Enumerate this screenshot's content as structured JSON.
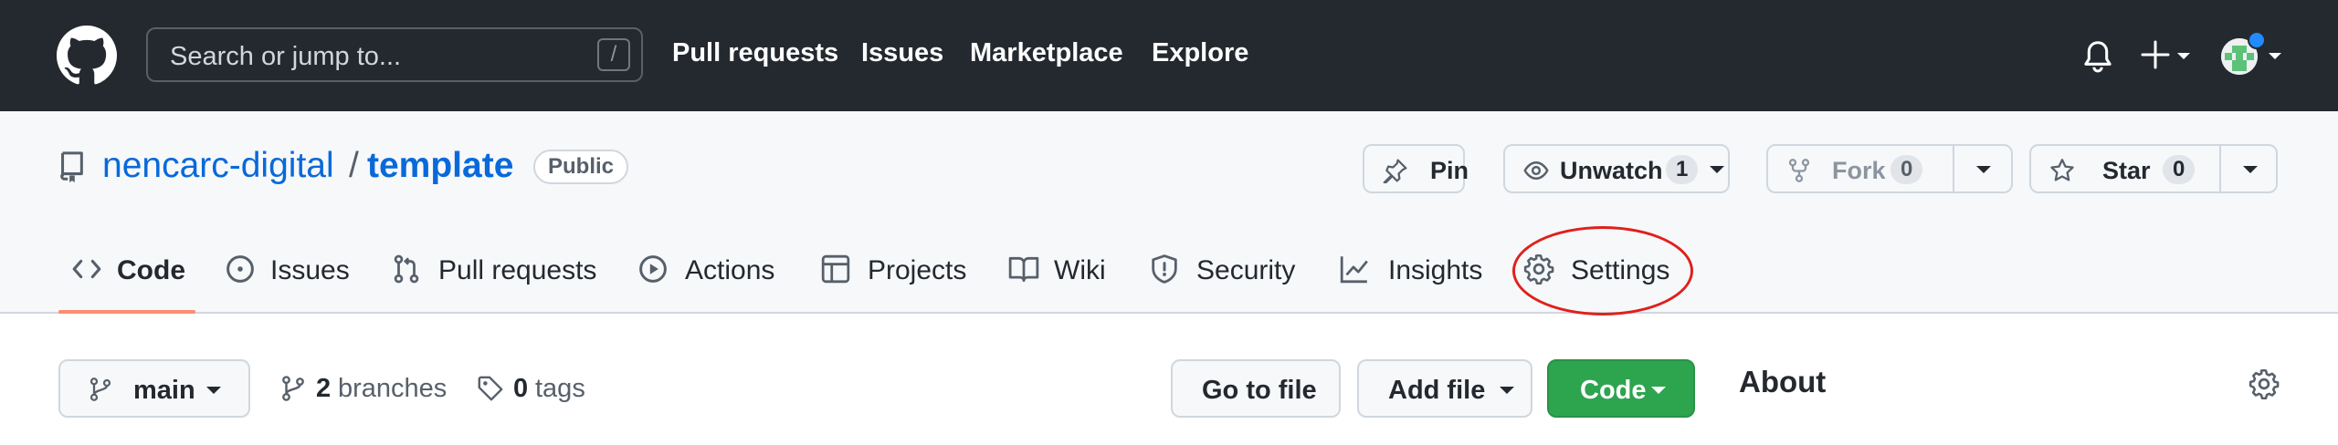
{
  "header": {
    "search_placeholder": "Search or jump to...",
    "search_shortcut": "/",
    "nav": [
      "Pull requests",
      "Issues",
      "Marketplace",
      "Explore"
    ]
  },
  "repo": {
    "owner": "nencarc-digital",
    "separator": "/",
    "name": "template",
    "visibility": "Public",
    "actions": {
      "pin": "Pin",
      "unwatch": "Unwatch",
      "unwatch_count": "1",
      "fork": "Fork",
      "fork_count": "0",
      "star": "Star",
      "star_count": "0"
    }
  },
  "tabs": [
    "Code",
    "Issues",
    "Pull requests",
    "Actions",
    "Projects",
    "Wiki",
    "Security",
    "Insights",
    "Settings"
  ],
  "active_tab": "Code",
  "filenav": {
    "branch": "main",
    "branches_count": "2",
    "branches_label": "branches",
    "tags_count": "0",
    "tags_label": "tags",
    "go_to_file": "Go to file",
    "add_file": "Add file",
    "code": "Code"
  },
  "sidebar": {
    "about_title": "About"
  },
  "colors": {
    "header_bg": "#24292f",
    "link": "#0969da",
    "active_tab_underline": "#fd8c73",
    "primary_button": "#2da44e",
    "annotation_circle": "#e0201b"
  },
  "icons": [
    "github-logo-icon",
    "bell-icon",
    "plus-icon",
    "repo-icon",
    "pin-icon",
    "eye-icon",
    "fork-icon",
    "star-icon",
    "code-icon",
    "issue-icon",
    "pull-request-icon",
    "play-icon",
    "table-icon",
    "book-icon",
    "shield-icon",
    "graph-icon",
    "gear-icon",
    "branch-icon",
    "tag-icon"
  ]
}
